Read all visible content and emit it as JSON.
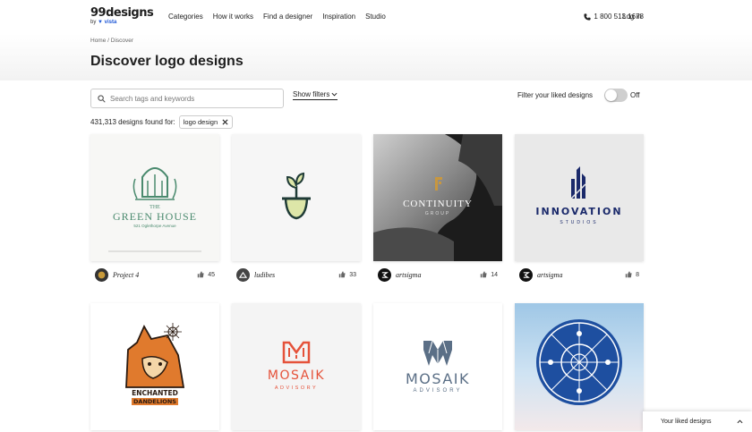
{
  "brand": {
    "name": "99designs",
    "by": "by",
    "vista": "vista"
  },
  "nav": {
    "items": [
      "Categories",
      "How it works",
      "Find a designer",
      "Inspiration",
      "Studio"
    ],
    "phone": "1 800 513 1678",
    "login": "Log in"
  },
  "breadcrumb": {
    "home": "Home",
    "sep": "/",
    "current": "Discover"
  },
  "page_title": "Discover logo designs",
  "search": {
    "placeholder": "Search tags and keywords"
  },
  "show_filters": "Show filters",
  "filter_liked": {
    "label": "Filter your liked designs",
    "state": "Off"
  },
  "results": {
    "count_text": "431,313 designs found for:",
    "chip": "logo design"
  },
  "cards": [
    {
      "designer": "Project 4",
      "likes": "45",
      "logo_title": "THE",
      "logo_main": "GREEN HOUSE",
      "logo_sub": "521 Oglethorpe Avenue"
    },
    {
      "designer": "ludibes",
      "likes": "33"
    },
    {
      "designer": "artsigma",
      "likes": "14",
      "logo_main": "CONTINUITY",
      "logo_sub": "GROUP"
    },
    {
      "designer": "artsigma",
      "likes": "8",
      "logo_main": "INNOVATION",
      "logo_sub": "STUDIOS"
    },
    {
      "logo_main": "ENCHANTED",
      "logo_sub": "DANDELIONS"
    },
    {
      "logo_main": "MOSAIK",
      "logo_sub": "ADVISORY"
    },
    {
      "logo_main": "MOSAIK",
      "logo_sub": "ADVISORY"
    },
    {}
  ],
  "liked_panel": {
    "label": "Your liked designs"
  },
  "colors": {
    "green": "#4a8a6e",
    "navy": "#1b2a6b",
    "coral": "#e5523a",
    "slate": "#5b6f86",
    "orange": "#e07a2d",
    "blue": "#1e4fa0"
  }
}
